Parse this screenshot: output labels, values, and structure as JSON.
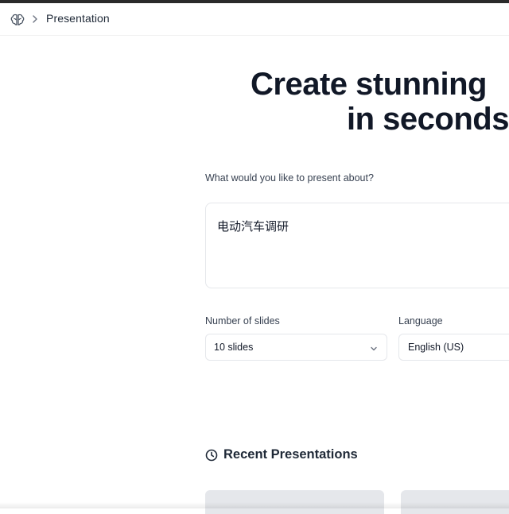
{
  "header": {
    "breadcrumb_icon": "brain-icon",
    "separator_icon": "chevron-right-icon",
    "title": "Presentation"
  },
  "hero": {
    "line1": "Create stunning",
    "line2": "in seconds"
  },
  "form": {
    "prompt_label": "What would you like to present about?",
    "prompt_value": "电动汽车调研",
    "slides": {
      "label": "Number of slides",
      "value": "10 slides"
    },
    "language": {
      "label": "Language",
      "value": "English (US)"
    }
  },
  "recent": {
    "icon": "clock-icon",
    "title": "Recent Presentations"
  },
  "colors": {
    "text": "#111827",
    "muted": "#374151",
    "border": "#e5e7eb",
    "skeleton": "#e5e7eb"
  }
}
